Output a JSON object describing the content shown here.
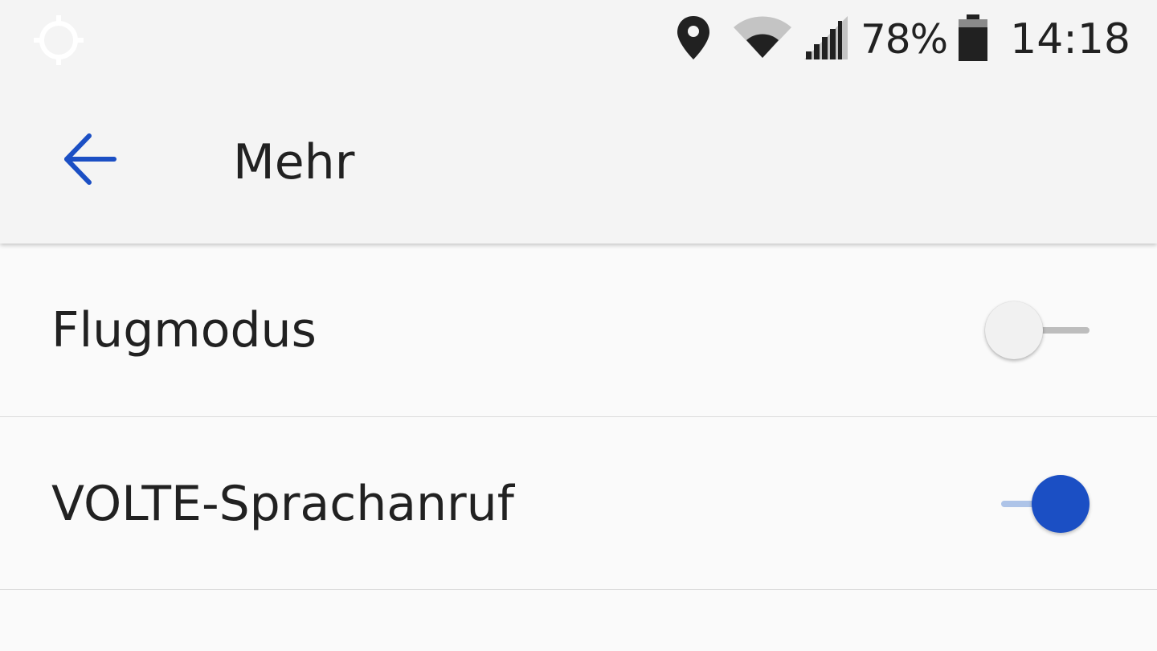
{
  "status_bar": {
    "left_icon": "gps-crosshair-icon",
    "icons": [
      "location-pin-icon",
      "wifi-icon",
      "cell-signal-icon",
      "battery-icon"
    ],
    "battery_percent": "78%",
    "time": "14:18"
  },
  "toolbar": {
    "back_icon": "arrow-back-icon",
    "title": "Mehr"
  },
  "settings": [
    {
      "label": "Flugmodus",
      "enabled": false
    },
    {
      "label": "VOLTE-Sprachanruf",
      "enabled": true
    }
  ],
  "colors": {
    "accent": "#1b4fc4",
    "accent_track": "#aec4e8",
    "appbar_bg": "#f4f4f4",
    "list_bg": "#fafafa",
    "text": "#212121"
  }
}
